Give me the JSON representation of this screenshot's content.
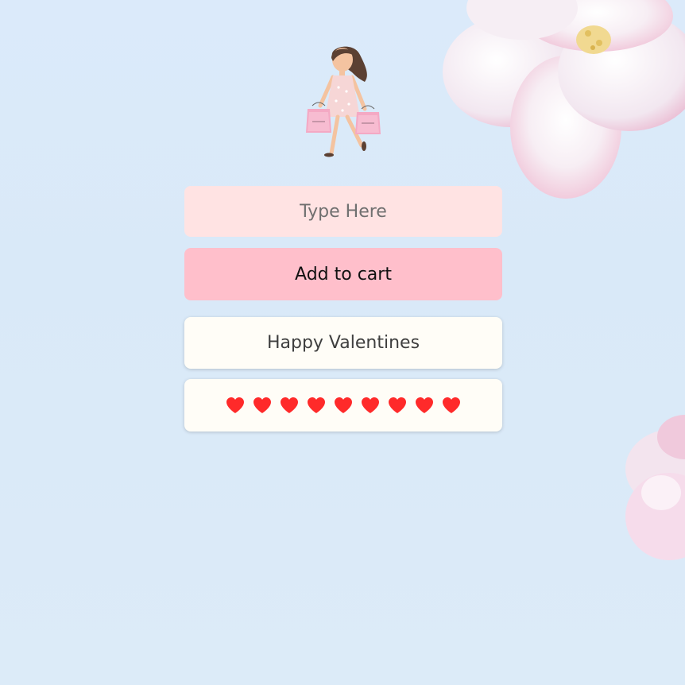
{
  "input": {
    "placeholder": "Type Here",
    "value": ""
  },
  "button": {
    "label": "Add to cart"
  },
  "message": {
    "text": "Happy Valentines"
  },
  "hearts": {
    "count": 9,
    "color": "#ff2a2a"
  },
  "colors": {
    "background": "#dbeafa",
    "input_bg": "#ffe3e3",
    "button_bg": "#ffbfcb",
    "card_bg": "#fffdf7"
  },
  "icons": {
    "avatar": "shopping-girl-avatar",
    "decoration": "cherry-blossom-flower"
  }
}
